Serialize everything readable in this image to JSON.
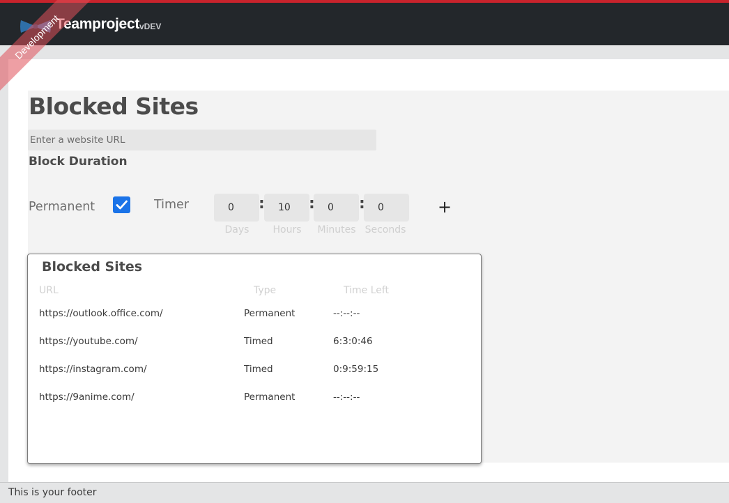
{
  "header": {
    "brand": "Teamproject",
    "tag": "vDEV",
    "env_ribbon": "Development",
    "logo_icon": "bowtie-logo-icon"
  },
  "page": {
    "title": "Blocked Sites",
    "url_placeholder": "Enter a website URL",
    "duration_heading": "Block Duration",
    "permanent_label": "Permanent",
    "permanent_checked": true,
    "timer_label": "Timer",
    "timer": {
      "days": "0",
      "hours": "10",
      "minutes": "0",
      "seconds": "0",
      "days_caption": "Days",
      "hours_caption": "Hours",
      "minutes_caption": "Minutes",
      "seconds_caption": "Seconds"
    },
    "add_label": "+"
  },
  "list": {
    "title": "Blocked Sites",
    "columns": [
      "URL",
      "Type",
      "Time Left"
    ],
    "rows": [
      {
        "url": "https://outlook.office.com/",
        "type": "Permanent",
        "time_left": "--:--:--"
      },
      {
        "url": "https://youtube.com/",
        "type": "Timed",
        "time_left": "6:3:0:46"
      },
      {
        "url": "https://instagram.com/",
        "type": "Timed",
        "time_left": "0:9:59:15"
      },
      {
        "url": "https://9anime.com/",
        "type": "Permanent",
        "time_left": "--:--:--"
      }
    ]
  },
  "footer": {
    "text": "This is your footer"
  },
  "colors": {
    "accent_red": "#c8232c",
    "topbar_bg": "#23272b",
    "checkbox_blue": "#1a73e8",
    "logo_blue": "#2f6fa8"
  }
}
